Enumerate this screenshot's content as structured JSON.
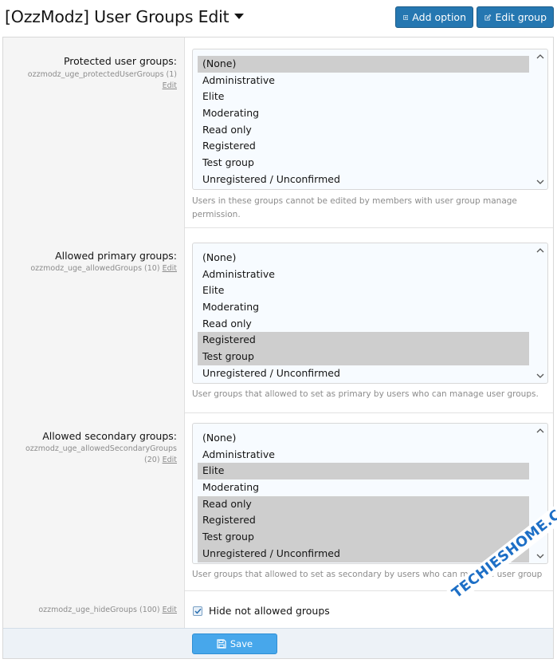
{
  "header": {
    "title": "[OzzModz] User Groups Edit",
    "add_option_label": "Add option",
    "edit_group_label": "Edit group"
  },
  "fields": {
    "protected": {
      "label": "Protected user groups:",
      "key": "ozzmodz_uge_protectedUserGroups (1)",
      "edit": "Edit",
      "explain": "Users in these groups cannot be edited by members with user group manage permission.",
      "options": [
        {
          "label": "(None)",
          "selected": true
        },
        {
          "label": "Administrative",
          "selected": false
        },
        {
          "label": "Elite",
          "selected": false
        },
        {
          "label": "Moderating",
          "selected": false
        },
        {
          "label": "Read only",
          "selected": false
        },
        {
          "label": "Registered",
          "selected": false
        },
        {
          "label": "Test group",
          "selected": false
        },
        {
          "label": "Unregistered / Unconfirmed",
          "selected": false
        }
      ]
    },
    "allowed_primary": {
      "label": "Allowed primary groups:",
      "key": "ozzmodz_uge_allowedGroups (10)",
      "edit": "Edit",
      "explain": "User groups that allowed to set as primary by users who can manage user groups.",
      "options": [
        {
          "label": "(None)",
          "selected": false
        },
        {
          "label": "Administrative",
          "selected": false
        },
        {
          "label": "Elite",
          "selected": false
        },
        {
          "label": "Moderating",
          "selected": false
        },
        {
          "label": "Read only",
          "selected": false
        },
        {
          "label": "Registered",
          "selected": true
        },
        {
          "label": "Test group",
          "selected": true
        },
        {
          "label": "Unregistered / Unconfirmed",
          "selected": false
        }
      ]
    },
    "allowed_secondary": {
      "label": "Allowed secondary groups:",
      "key": "ozzmodz_uge_allowedSecondaryGroups",
      "key2": "(20)",
      "edit": "Edit",
      "explain": "User groups that allowed to set as secondary by users who can manage user groups.",
      "options": [
        {
          "label": "(None)",
          "selected": false
        },
        {
          "label": "Administrative",
          "selected": false
        },
        {
          "label": "Elite",
          "selected": true
        },
        {
          "label": "Moderating",
          "selected": false
        },
        {
          "label": "Read only",
          "selected": true
        },
        {
          "label": "Registered",
          "selected": true
        },
        {
          "label": "Test group",
          "selected": true
        },
        {
          "label": "Unregistered / Unconfirmed",
          "selected": true
        }
      ]
    },
    "hide": {
      "key": "ozzmodz_uge_hideGroups (100)",
      "edit": "Edit",
      "checkbox_label": "Hide not allowed groups",
      "checked": true
    }
  },
  "footer": {
    "save_label": "Save"
  },
  "watermark": "TECHIESHOME.COM",
  "colors": {
    "primary_button": "#2577b1",
    "save_button": "#47a7eb",
    "selected_option": "#cecece",
    "watermark": "#1d6fc6"
  }
}
